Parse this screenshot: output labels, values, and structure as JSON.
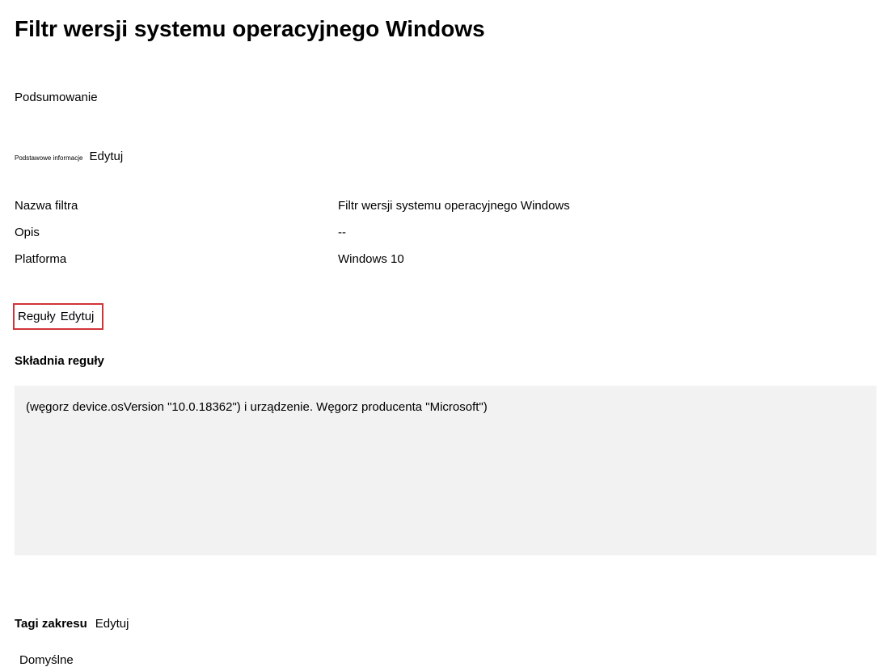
{
  "title": "Filtr wersji systemu operacyjnego Windows",
  "summary_label": "Podsumowanie",
  "basics": {
    "tiny_label": "Podstawowe informacje",
    "edit_label": "Edytuj"
  },
  "info": {
    "filter_name_label": "Nazwa filtra",
    "filter_name_value": "Filtr wersji systemu operacyjnego Windows",
    "description_label": "Opis",
    "description_value": "--",
    "platform_label": "Platforma",
    "platform_value": "Windows 10"
  },
  "rules": {
    "label": "Reguły",
    "edit_label": "Edytuj"
  },
  "syntax": {
    "title": "Składnia reguły",
    "content": "(węgorz device.osVersion \"10.0.18362\") i urządzenie. Węgorz producenta \"Microsoft\")"
  },
  "scope": {
    "label": "Tagi zakresu",
    "edit_label": "Edytuj",
    "value": "Domyślne"
  }
}
